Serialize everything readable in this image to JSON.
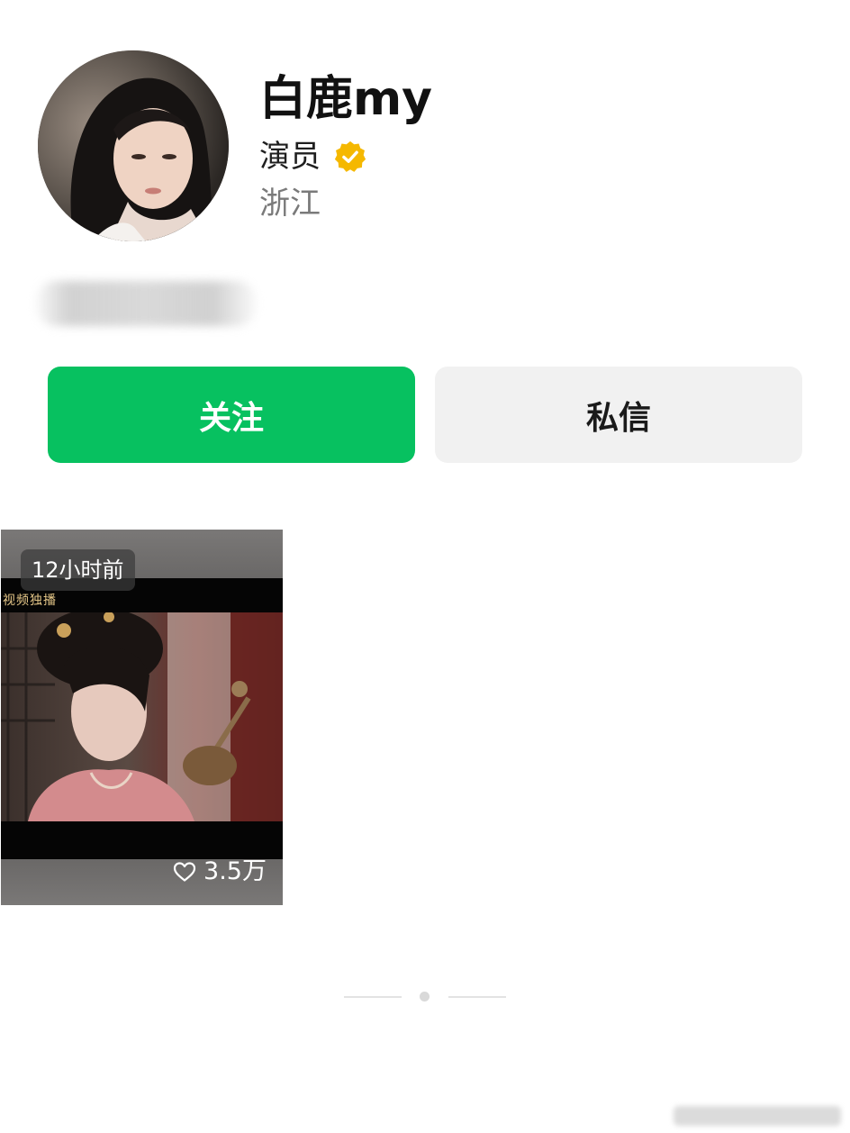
{
  "profile": {
    "name": "白鹿my",
    "role": "演员",
    "location": "浙江",
    "verified_icon": "verified-badge-icon",
    "verified_color": "#f5b800"
  },
  "actions": {
    "follow_label": "关注",
    "message_label": "私信",
    "follow_color": "#07c160"
  },
  "videos": [
    {
      "time_ago": "12小时前",
      "watermark": "视频独播",
      "likes": "3.5万",
      "like_icon": "heart-outline-icon"
    }
  ]
}
